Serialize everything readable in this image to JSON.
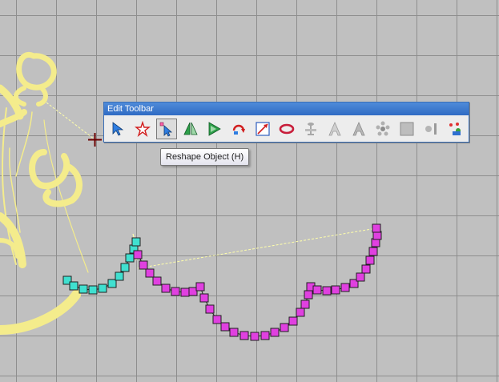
{
  "window": {
    "title": "Edit Toolbar"
  },
  "tooltip": {
    "text": "Reshape Object (H)"
  },
  "tools": [
    {
      "name": "select-object",
      "icon": "arrow-select-icon"
    },
    {
      "name": "polyline-select",
      "icon": "star-select-icon"
    },
    {
      "name": "reshape-object",
      "icon": "reshape-arrow-icon",
      "active": true
    },
    {
      "name": "mirror-horizontal",
      "icon": "mirror-triangle-icon"
    },
    {
      "name": "mirror-vertical",
      "icon": "mirror-triangle-right-icon"
    },
    {
      "name": "rotate",
      "icon": "rotate-arrow-icon"
    },
    {
      "name": "scale",
      "icon": "scale-box-icon"
    },
    {
      "name": "connect",
      "icon": "red-loop-icon"
    },
    {
      "name": "align",
      "icon": "align-grey-icon"
    },
    {
      "name": "outline-a",
      "icon": "letter-a-outline-icon"
    },
    {
      "name": "fill-a",
      "icon": "letter-a-fill-icon"
    },
    {
      "name": "fan",
      "icon": "fan-grey-icon"
    },
    {
      "name": "block",
      "icon": "square-grey-icon"
    },
    {
      "name": "spark",
      "icon": "spark-grey-icon"
    },
    {
      "name": "generate",
      "icon": "magic-wand-icon"
    }
  ],
  "colors": {
    "canvas": "#c0c0c0",
    "grid": "#8e8e8e",
    "embroidery": "#f4ec8c",
    "node_cyan": "#40e0d0",
    "node_magenta": "#e040e0",
    "titlebar": "#3a7bd5"
  }
}
